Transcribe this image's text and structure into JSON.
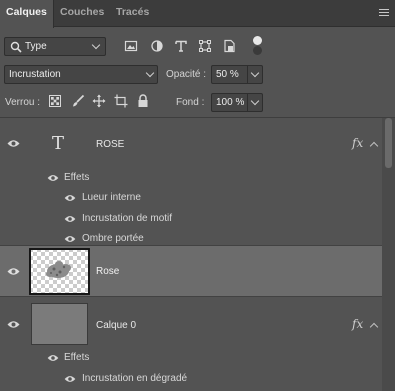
{
  "tabs": [
    {
      "label": "Calques",
      "active": true
    },
    {
      "label": "Couches",
      "active": false
    },
    {
      "label": "Tracés",
      "active": false
    }
  ],
  "filter": {
    "kind_label": "Type",
    "icons": [
      "image-filter-icon",
      "adjustment-filter-icon",
      "text-filter-icon",
      "shape-filter-icon",
      "smart-object-filter-icon"
    ]
  },
  "blend": {
    "mode": "Incrustation",
    "opacity_label": "Opacité :",
    "opacity_value": "50 %"
  },
  "lock": {
    "label": "Verrou :",
    "fill_label": "Fond :",
    "fill_value": "100 %",
    "icons": [
      "lock-transparent-pixels-icon",
      "lock-image-pixels-icon",
      "lock-position-icon",
      "lock-artboard-icon",
      "lock-all-icon"
    ]
  },
  "layers": [
    {
      "name": "ROSE",
      "type": "text",
      "thumb_glyph": "T",
      "fx": "fx",
      "effects_label": "Effets",
      "effects": [
        "Lueur interne",
        "Incrustation de motif",
        "Ombre portée"
      ]
    },
    {
      "name": "Rose",
      "type": "pixel",
      "selected": true
    },
    {
      "name": "Calque 0",
      "type": "pixel",
      "fx": "fx",
      "effects_label": "Effets",
      "effects": [
        "Incrustation en dégradé"
      ]
    }
  ],
  "colors": {
    "panel_bg": "#535353",
    "selected_row": "#6c6c6c",
    "tab_bar": "#3c3c3c"
  }
}
